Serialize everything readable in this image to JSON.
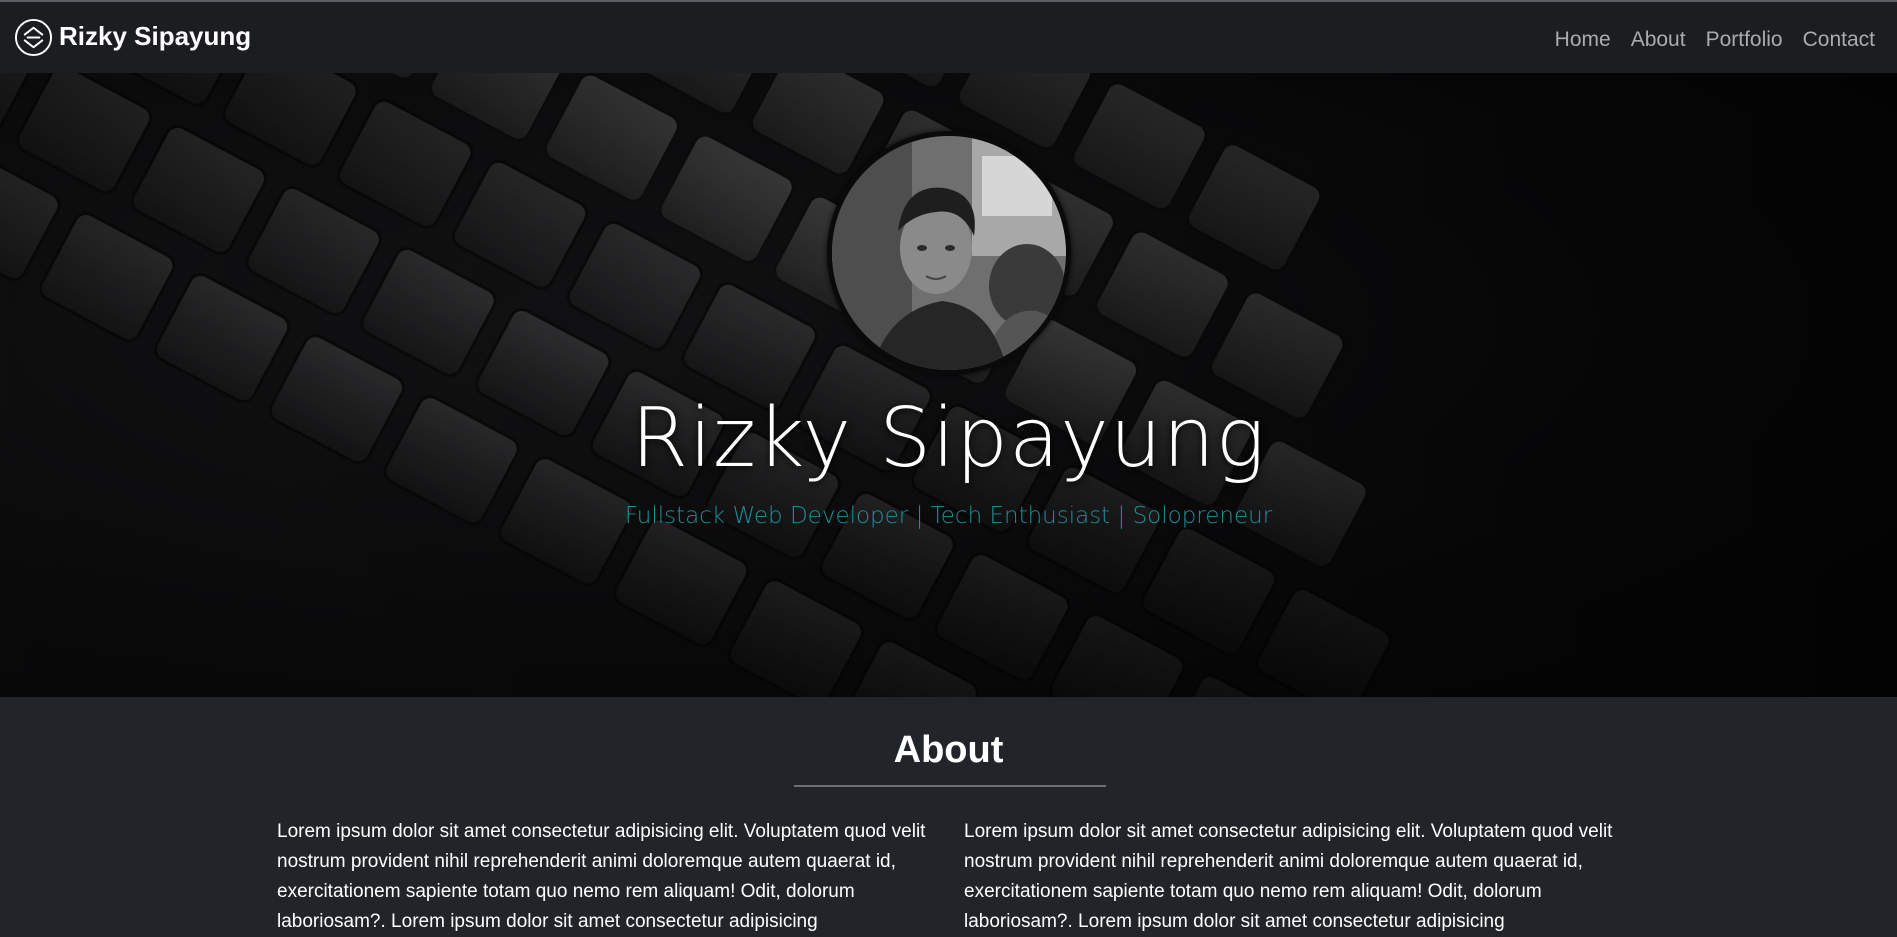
{
  "navbar": {
    "brand": "Rizky Sipayung",
    "logo_icon": "circle-monogram-logo",
    "links": [
      "Home",
      "About",
      "Portfolio",
      "Contact"
    ]
  },
  "hero": {
    "name": "Rizky Sipayung",
    "subtitle": "Fullstack Web Developer | Tech Enthusiast | Solopreneur",
    "subtitle_color": "#1f8d96"
  },
  "about": {
    "title": "About",
    "columns": [
      "Lorem ipsum dolor sit amet consectetur adipisicing elit. Voluptatem quod velit nostrum provident nihil reprehenderit animi doloremque autem quaerat id, exercitationem sapiente totam quo nemo rem aliquam! Odit, dolorum laboriosam?. Lorem ipsum dolor sit amet consectetur adipisicing",
      "Lorem ipsum dolor sit amet consectetur adipisicing elit. Voluptatem quod velit nostrum provident nihil reprehenderit animi doloremque autem quaerat id, exercitationem sapiente totam quo nemo rem aliquam! Odit, dolorum laboriosam?. Lorem ipsum dolor sit amet consectetur adipisicing"
    ]
  },
  "theme": {
    "navbar_bg": "#1b1d21",
    "page_bg": "#212529",
    "nav_link_color": "#a9abae"
  }
}
